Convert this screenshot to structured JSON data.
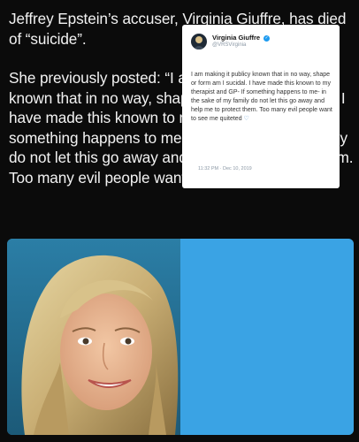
{
  "post": {
    "paragraph1": "Jeffrey Epstein’s accuser, Virginia Giuffre, has died of “suicide”.",
    "paragraph2": "She previously posted: “I am making it publicy known that in no way, shape or form am I sucidal. I have made this known to my therapist and GP- If something happens to me- in the sake of my family do not let this go away and help me to protect them. Too many evil people want to see me quiteted”"
  },
  "tweet": {
    "name": "Virginia Giuffre",
    "handle": "@VRSVirginia",
    "body": "I am making it publicy known that in no way, shape or form am I sucidal. I have made this known to my therapist and GP- If something happens to me- in the sake of my family do not let this go away and help me to protect them. Too many evil people want to see me quiteted",
    "emoji": "♡",
    "timestamp": "11:32 PM · Dec 10, 2019"
  },
  "colors": {
    "background": "#0b0b0b",
    "text": "#f2f2f2",
    "tweet_bg": "#3aa3e4",
    "verified": "#1d9bf0"
  }
}
